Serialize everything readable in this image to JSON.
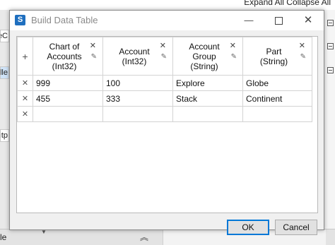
{
  "background_app": {
    "top_text": "Expand All  Collapse All",
    "left_items": [
      "eC",
      "lle",
      "utp"
    ],
    "bottom_label": "le"
  },
  "dialog": {
    "title": "Build Data Table",
    "add_row_glyph": "+",
    "columns": [
      {
        "name": "Chart of Accounts (Int32)"
      },
      {
        "name": "Account (Int32)"
      },
      {
        "name": "Account Group (String)"
      },
      {
        "name": "Part (String)"
      }
    ],
    "rows": [
      [
        "999",
        "100",
        "Explore",
        "Globe"
      ],
      [
        "455",
        "333",
        "Stack",
        "Continent"
      ],
      [
        "",
        "",
        "",
        ""
      ]
    ],
    "buttons": {
      "ok": "OK",
      "cancel": "Cancel"
    }
  }
}
